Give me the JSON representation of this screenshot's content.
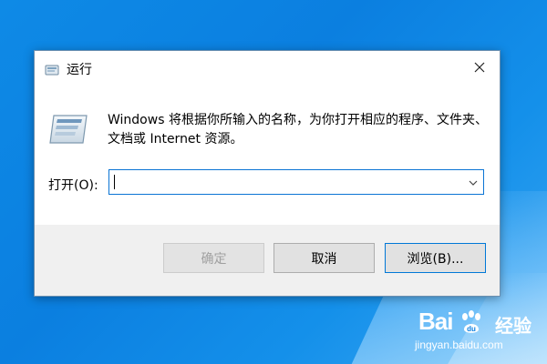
{
  "dialog": {
    "title": "运行",
    "message": "Windows 将根据你所输入的名称，为你打开相应的程序、文件夹、文档或 Internet 资源。",
    "open_label": "打开(O):",
    "open_value": "",
    "buttons": {
      "ok": "确定",
      "cancel": "取消",
      "browse": "浏览(B)..."
    }
  },
  "icons": {
    "title": "run-app-icon",
    "big": "run-app-icon",
    "close": "close-icon",
    "dropdown": "chevron-down-icon"
  },
  "watermark": {
    "brand_left": "Bai",
    "brand_right": "经验",
    "url": "jingyan.baidu.com"
  },
  "colors": {
    "accent": "#0078d7",
    "desktop": "#0b7fe0",
    "footer": "#f0f0f0"
  }
}
